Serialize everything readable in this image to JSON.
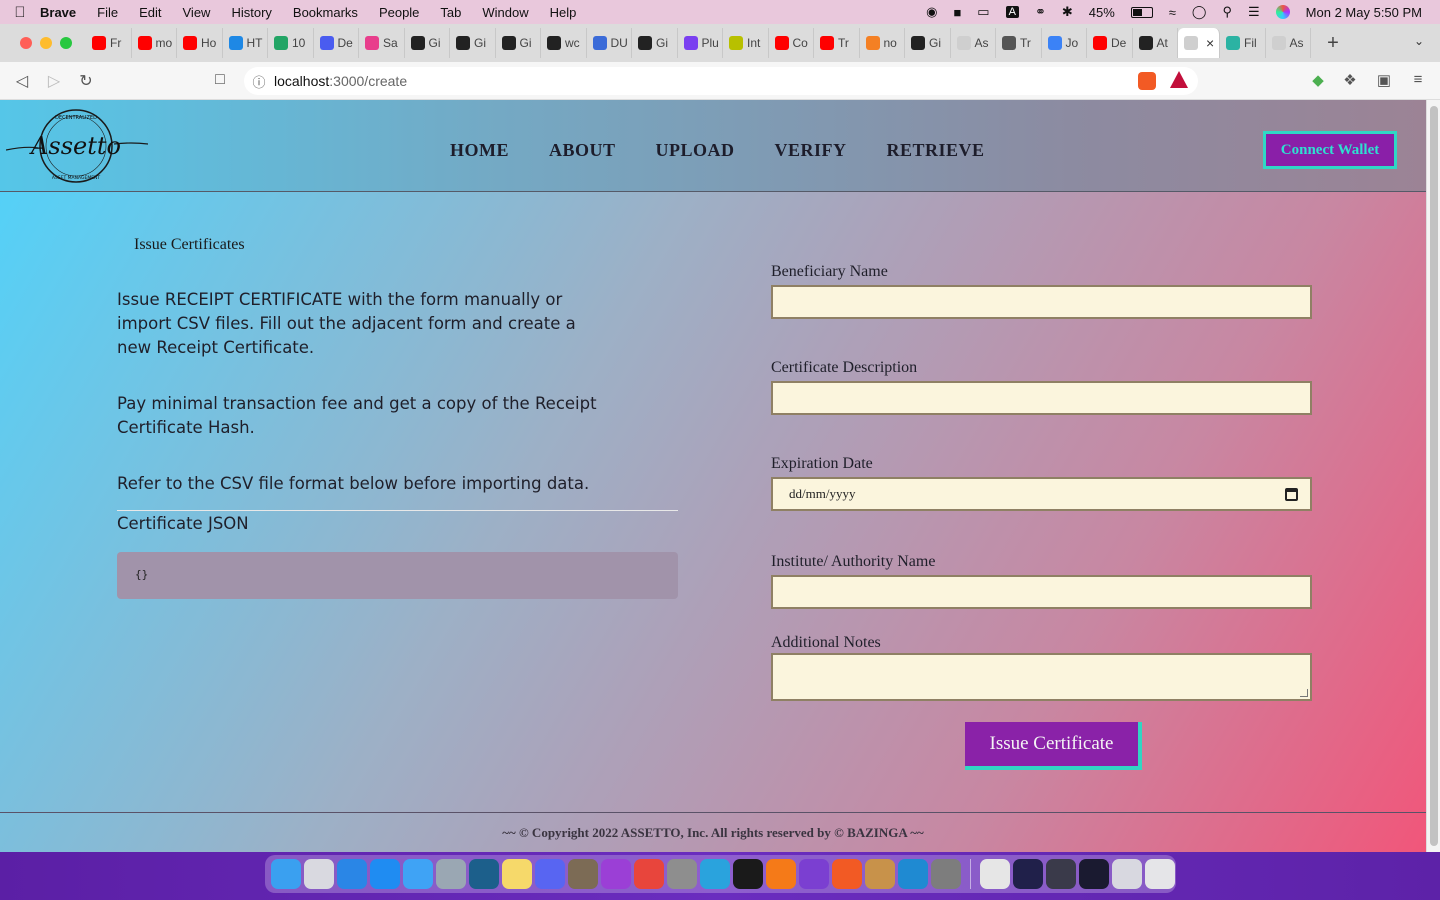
{
  "menubar": {
    "app": "Brave",
    "items": [
      "File",
      "Edit",
      "View",
      "History",
      "Bookmarks",
      "People",
      "Tab",
      "Window",
      "Help"
    ],
    "battery": "45%",
    "datetime": "Mon 2 May  5:50 PM"
  },
  "browser": {
    "tabs": [
      {
        "label": "Fr",
        "color": "#ff0000"
      },
      {
        "label": "mo",
        "color": "#ff0000"
      },
      {
        "label": "Ho",
        "color": "#ff0000"
      },
      {
        "label": "HT",
        "color": "#1e88e5"
      },
      {
        "label": "10",
        "color": "#22a565"
      },
      {
        "label": "De",
        "color": "#4a5cf0"
      },
      {
        "label": "Sa",
        "color": "#e83e8c"
      },
      {
        "label": "Gi",
        "color": "#222222"
      },
      {
        "label": "Gi",
        "color": "#222222"
      },
      {
        "label": "Gi",
        "color": "#222222"
      },
      {
        "label": "wc",
        "color": "#222222"
      },
      {
        "label": "DU",
        "color": "#3b6bd8"
      },
      {
        "label": "Gi",
        "color": "#222222"
      },
      {
        "label": "Plu",
        "color": "#7a3ff0"
      },
      {
        "label": "Int",
        "color": "#b8c000"
      },
      {
        "label": "Co",
        "color": "#ff0000"
      },
      {
        "label": "Tr",
        "color": "#ff0000"
      },
      {
        "label": "no",
        "color": "#f48024"
      },
      {
        "label": "Gi",
        "color": "#222222"
      },
      {
        "label": "As",
        "color": "#cfcfcf"
      },
      {
        "label": "Tr",
        "color": "#555555"
      },
      {
        "label": "Jo",
        "color": "#3b82f6"
      },
      {
        "label": "De",
        "color": "#ff0000"
      },
      {
        "label": "At",
        "color": "#222222"
      },
      {
        "label": "",
        "color": "#cfcfcf",
        "active": true
      },
      {
        "label": "Fil",
        "color": "#2bb3a3"
      },
      {
        "label": "As",
        "color": "#cfcfcf"
      }
    ],
    "url_host": "localhost",
    "url_path": ":3000/create"
  },
  "site": {
    "logo_text": "Assetto",
    "logo_ring_top": "DECENTRALIZED",
    "logo_ring_bottom": "ASSET MANAGEMENT",
    "nav": [
      "HOME",
      "ABOUT",
      "UPLOAD",
      "VERIFY",
      "RETRIEVE"
    ],
    "connect_wallet": "Connect Wallet"
  },
  "main": {
    "breadcrumb": "Issue Certificates",
    "intro": "Issue RECEIPT CERTIFICATE with the form manually or import CSV files. Fill out the adjacent form and create a new Receipt Certificate.",
    "fee": "Pay minimal transaction fee and get a copy of the Receipt Certificate Hash.",
    "csv_note": "Refer to the CSV file format below before importing data.",
    "json_label": "Certificate JSON",
    "json_value": "{}"
  },
  "form": {
    "beneficiary_label": "Beneficiary Name",
    "beneficiary_value": "",
    "description_label": "Certificate Description",
    "description_value": "",
    "expiration_label": "Expiration Date",
    "expiration_placeholder": "dd/mm/yyyy",
    "institute_label": "Institute/ Authority Name",
    "institute_value": "",
    "notes_label": "Additional Notes",
    "notes_value": "",
    "submit": "Issue Certificate"
  },
  "footer": {
    "text": "~~ © Copyright 2022 ASSETTO, Inc. All rights reserved by © BAZINGA ~~"
  },
  "dock": {
    "apps": [
      {
        "name": "finder-icon",
        "color": "#3aa0f0"
      },
      {
        "name": "launchpad-icon",
        "color": "#d9d9e0"
      },
      {
        "name": "safari-icon",
        "color": "#2a86e6"
      },
      {
        "name": "app-store-icon",
        "color": "#1f8cf2"
      },
      {
        "name": "mail-icon",
        "color": "#3fa3f5"
      },
      {
        "name": "preview-icon",
        "color": "#9aa7b3"
      },
      {
        "name": "mysql-workbench-icon",
        "color": "#1c5f8b"
      },
      {
        "name": "notes-icon",
        "color": "#f6d96a"
      },
      {
        "name": "discord-icon",
        "color": "#5865f2"
      },
      {
        "name": "gimp-icon",
        "color": "#7c6b55"
      },
      {
        "name": "podcasts-icon",
        "color": "#9b3fd6"
      },
      {
        "name": "chrome-icon",
        "color": "#e8453c"
      },
      {
        "name": "image-capture-icon",
        "color": "#8e8e8e"
      },
      {
        "name": "telegram-icon",
        "color": "#2aa3dd"
      },
      {
        "name": "terminal-icon",
        "color": "#1a1a1a"
      },
      {
        "name": "sublime-text-icon",
        "color": "#f57a18"
      },
      {
        "name": "github-desktop-icon",
        "color": "#7b3fd1"
      },
      {
        "name": "brave-icon",
        "color": "#f25a24"
      },
      {
        "name": "package-icon",
        "color": "#c8924a"
      },
      {
        "name": "vscode-icon",
        "color": "#1f8ad2"
      },
      {
        "name": "system-preferences-icon",
        "color": "#7d7d7d"
      }
    ],
    "recents": [
      {
        "name": "recent-window-1-icon",
        "color": "#e6e6e6"
      },
      {
        "name": "recent-window-2-icon",
        "color": "#20204a"
      },
      {
        "name": "recent-window-3-icon",
        "color": "#3a3a4a"
      },
      {
        "name": "recent-window-4-icon",
        "color": "#1a1a30"
      },
      {
        "name": "recent-window-5-icon",
        "color": "#d8d8e0"
      },
      {
        "name": "trash-icon",
        "color": "#e5e5e8"
      }
    ]
  }
}
